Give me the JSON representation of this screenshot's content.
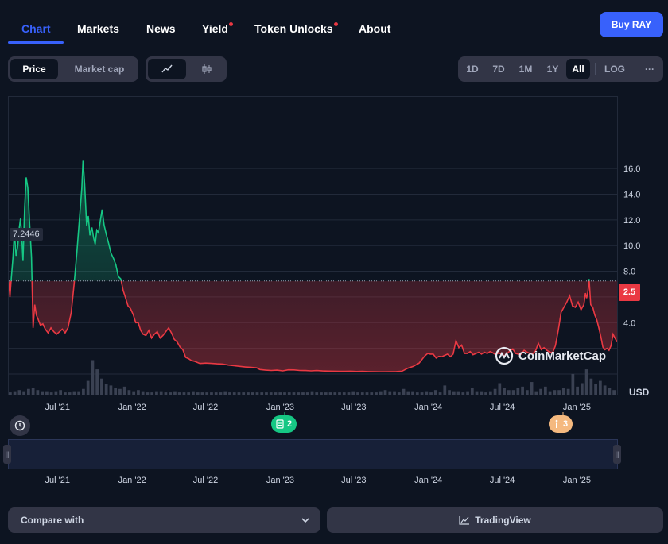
{
  "nav": {
    "tabs": [
      {
        "label": "Chart",
        "active": true
      },
      {
        "label": "Markets"
      },
      {
        "label": "News"
      },
      {
        "label": "Yield",
        "dot": true
      },
      {
        "label": "Token Unlocks",
        "dot": true
      },
      {
        "label": "About"
      }
    ],
    "buy_label": "Buy RAY"
  },
  "toolbar": {
    "metric_toggle": [
      "Price",
      "Market cap"
    ],
    "metric_selected": "Price",
    "chart_type_icons": [
      "line-chart-icon",
      "candlestick-icon"
    ],
    "ranges": [
      "1D",
      "7D",
      "1M",
      "1Y",
      "All"
    ],
    "range_selected": "All",
    "log_label": "LOG",
    "more_label": "···"
  },
  "chart": {
    "current_value_label": "7.2446",
    "last_price_label": "2.5",
    "currency_label": "USD",
    "watermark": "CoinMarketCap",
    "markers": [
      {
        "icon": "document-icon",
        "count": "2"
      },
      {
        "icon": "info-icon",
        "count": "3"
      }
    ]
  },
  "chart_data": {
    "type": "line",
    "ylim": [
      0,
      17
    ],
    "yticks": [
      4.0,
      6.0,
      8.0,
      10.0,
      12.0,
      14.0,
      16.0
    ],
    "ytick_labels": [
      "4.0",
      "6.0",
      "8.0",
      "10.0",
      "12.0",
      "14.0",
      "16.0"
    ],
    "xlim": [
      "2021-03-03",
      "2025-04-10"
    ],
    "xtick_dates": [
      "2021-07-01",
      "2022-01-01",
      "2022-07-01",
      "2023-01-01",
      "2023-07-01",
      "2024-01-01",
      "2024-07-01",
      "2025-01-01"
    ],
    "xtick_labels": [
      "Jul '21",
      "Jan '22",
      "Jul '22",
      "Jan '23",
      "Jul '23",
      "Jan '24",
      "Jul '24",
      "Jan '25"
    ],
    "baseline": 7.2446,
    "colors": {
      "up": "#16c784",
      "down": "#ea3943",
      "volume": "#3a4152",
      "navigator": "#3861fb"
    },
    "grid": true,
    "series": [
      {
        "points": [
          [
            "2021-03-03",
            7.2
          ],
          [
            "2021-03-06",
            6.0
          ],
          [
            "2021-03-09",
            7.4
          ],
          [
            "2021-03-13",
            8.9
          ],
          [
            "2021-03-17",
            11.0
          ],
          [
            "2021-03-21",
            9.2
          ],
          [
            "2021-03-25",
            9.9
          ],
          [
            "2021-03-29",
            11.4
          ],
          [
            "2021-04-01",
            12.1
          ],
          [
            "2021-04-04",
            10.8
          ],
          [
            "2021-04-07",
            8.8
          ],
          [
            "2021-04-11",
            12.8
          ],
          [
            "2021-04-15",
            15.3
          ],
          [
            "2021-04-19",
            14.5
          ],
          [
            "2021-04-23",
            12.0
          ],
          [
            "2021-04-28",
            9.1
          ],
          [
            "2021-05-02",
            3.6
          ],
          [
            "2021-05-06",
            5.4
          ],
          [
            "2021-05-10",
            4.6
          ],
          [
            "2021-05-14",
            4.3
          ],
          [
            "2021-05-20",
            3.8
          ],
          [
            "2021-05-26",
            3.9
          ],
          [
            "2021-06-01",
            3.5
          ],
          [
            "2021-06-08",
            3.2
          ],
          [
            "2021-06-15",
            3.6
          ],
          [
            "2021-06-22",
            3.3
          ],
          [
            "2021-06-29",
            3.1
          ],
          [
            "2021-07-06",
            3.3
          ],
          [
            "2021-07-13",
            3.5
          ],
          [
            "2021-07-20",
            3.2
          ],
          [
            "2021-07-27",
            3.6
          ],
          [
            "2021-08-04",
            4.8
          ],
          [
            "2021-08-11",
            7.0
          ],
          [
            "2021-08-18",
            9.5
          ],
          [
            "2021-08-25",
            12.4
          ],
          [
            "2021-08-30",
            14.5
          ],
          [
            "2021-09-02",
            16.6
          ],
          [
            "2021-09-06",
            14.8
          ],
          [
            "2021-09-11",
            11.5
          ],
          [
            "2021-09-15",
            12.3
          ],
          [
            "2021-09-19",
            10.8
          ],
          [
            "2021-09-24",
            11.4
          ],
          [
            "2021-09-28",
            10.6
          ],
          [
            "2021-10-02",
            10.1
          ],
          [
            "2021-10-06",
            11.2
          ],
          [
            "2021-10-10",
            11.0
          ],
          [
            "2021-10-15",
            12.0
          ],
          [
            "2021-10-19",
            12.8
          ],
          [
            "2021-10-24",
            11.6
          ],
          [
            "2021-10-29",
            10.9
          ],
          [
            "2021-11-04",
            10.2
          ],
          [
            "2021-11-10",
            9.4
          ],
          [
            "2021-11-16",
            9.0
          ],
          [
            "2021-11-22",
            8.5
          ],
          [
            "2021-11-28",
            7.6
          ],
          [
            "2021-12-04",
            7.4
          ],
          [
            "2021-12-10",
            6.5
          ],
          [
            "2021-12-16",
            5.9
          ],
          [
            "2021-12-22",
            5.3
          ],
          [
            "2021-12-28",
            5.1
          ],
          [
            "2022-01-04",
            4.6
          ],
          [
            "2022-01-10",
            4.0
          ],
          [
            "2022-01-16",
            4.0
          ],
          [
            "2022-01-22",
            3.4
          ],
          [
            "2022-01-28",
            3.1
          ],
          [
            "2022-02-04",
            3.0
          ],
          [
            "2022-02-11",
            3.4
          ],
          [
            "2022-02-18",
            2.8
          ],
          [
            "2022-02-25",
            3.1
          ],
          [
            "2022-03-04",
            3.3
          ],
          [
            "2022-03-11",
            2.8
          ],
          [
            "2022-03-18",
            3.0
          ],
          [
            "2022-03-25",
            3.3
          ],
          [
            "2022-04-01",
            3.6
          ],
          [
            "2022-04-08",
            3.2
          ],
          [
            "2022-04-15",
            2.7
          ],
          [
            "2022-04-22",
            2.5
          ],
          [
            "2022-04-29",
            2.1
          ],
          [
            "2022-05-06",
            1.9
          ],
          [
            "2022-05-13",
            1.3
          ],
          [
            "2022-05-20",
            1.2
          ],
          [
            "2022-05-27",
            1.05
          ],
          [
            "2022-06-03",
            1.0
          ],
          [
            "2022-06-17",
            0.82
          ],
          [
            "2022-07-01",
            0.85
          ],
          [
            "2022-07-15",
            0.83
          ],
          [
            "2022-07-29",
            0.8
          ],
          [
            "2022-08-12",
            0.78
          ],
          [
            "2022-08-26",
            0.7
          ],
          [
            "2022-09-09",
            0.65
          ],
          [
            "2022-09-23",
            0.6
          ],
          [
            "2022-10-07",
            0.55
          ],
          [
            "2022-10-21",
            0.52
          ],
          [
            "2022-11-04",
            0.48
          ],
          [
            "2022-11-12",
            0.35
          ],
          [
            "2022-11-26",
            0.3
          ],
          [
            "2022-12-10",
            0.28
          ],
          [
            "2022-12-24",
            0.3
          ],
          [
            "2023-01-07",
            0.25
          ],
          [
            "2023-01-21",
            0.33
          ],
          [
            "2023-02-04",
            0.32
          ],
          [
            "2023-02-18",
            0.28
          ],
          [
            "2023-03-04",
            0.27
          ],
          [
            "2023-03-18",
            0.25
          ],
          [
            "2023-04-01",
            0.27
          ],
          [
            "2023-04-15",
            0.24
          ],
          [
            "2023-04-29",
            0.23
          ],
          [
            "2023-05-13",
            0.22
          ],
          [
            "2023-05-27",
            0.21
          ],
          [
            "2023-06-10",
            0.21
          ],
          [
            "2023-06-24",
            0.22
          ],
          [
            "2023-07-08",
            0.2
          ],
          [
            "2023-07-22",
            0.21
          ],
          [
            "2023-08-05",
            0.19
          ],
          [
            "2023-08-19",
            0.18
          ],
          [
            "2023-09-02",
            0.17
          ],
          [
            "2023-09-16",
            0.17
          ],
          [
            "2023-09-30",
            0.18
          ],
          [
            "2023-10-14",
            0.19
          ],
          [
            "2023-10-28",
            0.22
          ],
          [
            "2023-11-11",
            0.45
          ],
          [
            "2023-11-25",
            0.6
          ],
          [
            "2023-12-09",
            0.85
          ],
          [
            "2023-12-23",
            1.4
          ],
          [
            "2023-12-30",
            1.6
          ],
          [
            "2024-01-06",
            1.55
          ],
          [
            "2024-01-13",
            1.55
          ],
          [
            "2024-01-20",
            1.25
          ],
          [
            "2024-01-27",
            1.38
          ],
          [
            "2024-02-03",
            1.35
          ],
          [
            "2024-02-10",
            1.45
          ],
          [
            "2024-02-17",
            1.55
          ],
          [
            "2024-02-24",
            1.35
          ],
          [
            "2024-03-02",
            1.55
          ],
          [
            "2024-03-09",
            2.6
          ],
          [
            "2024-03-16",
            2.05
          ],
          [
            "2024-03-23",
            2.25
          ],
          [
            "2024-03-30",
            1.6
          ],
          [
            "2024-04-06",
            1.6
          ],
          [
            "2024-04-13",
            1.75
          ],
          [
            "2024-04-20",
            1.5
          ],
          [
            "2024-04-27",
            1.6
          ],
          [
            "2024-05-04",
            1.7
          ],
          [
            "2024-05-11",
            1.55
          ],
          [
            "2024-05-18",
            1.7
          ],
          [
            "2024-05-25",
            1.6
          ],
          [
            "2024-06-01",
            1.75
          ],
          [
            "2024-06-08",
            1.65
          ],
          [
            "2024-06-15",
            1.5
          ],
          [
            "2024-06-22",
            1.65
          ],
          [
            "2024-06-29",
            1.55
          ],
          [
            "2024-07-06",
            1.4
          ],
          [
            "2024-07-13",
            1.6
          ],
          [
            "2024-07-20",
            1.8
          ],
          [
            "2024-07-27",
            1.95
          ],
          [
            "2024-08-03",
            1.6
          ],
          [
            "2024-08-10",
            1.55
          ],
          [
            "2024-08-17",
            1.55
          ],
          [
            "2024-08-24",
            1.85
          ],
          [
            "2024-08-31",
            1.7
          ],
          [
            "2024-09-07",
            1.6
          ],
          [
            "2024-09-14",
            1.55
          ],
          [
            "2024-09-21",
            1.8
          ],
          [
            "2024-09-28",
            2.4
          ],
          [
            "2024-10-05",
            1.9
          ],
          [
            "2024-10-12",
            2.05
          ],
          [
            "2024-10-19",
            1.85
          ],
          [
            "2024-10-26",
            1.7
          ],
          [
            "2024-11-02",
            1.65
          ],
          [
            "2024-11-09",
            2.2
          ],
          [
            "2024-11-16",
            3.4
          ],
          [
            "2024-11-23",
            4.8
          ],
          [
            "2024-11-30",
            5.2
          ],
          [
            "2024-12-07",
            5.6
          ],
          [
            "2024-12-14",
            6.1
          ],
          [
            "2024-12-21",
            5.3
          ],
          [
            "2024-12-28",
            5.2
          ],
          [
            "2025-01-04",
            5.6
          ],
          [
            "2025-01-11",
            5.0
          ],
          [
            "2025-01-18",
            5.4
          ],
          [
            "2025-01-22",
            6.3
          ],
          [
            "2025-01-25",
            5.9
          ],
          [
            "2025-01-28",
            6.4
          ],
          [
            "2025-01-31",
            7.4
          ],
          [
            "2025-02-04",
            5.4
          ],
          [
            "2025-02-09",
            5.2
          ],
          [
            "2025-02-14",
            4.6
          ],
          [
            "2025-02-19",
            4.2
          ],
          [
            "2025-02-24",
            3.6
          ],
          [
            "2025-03-01",
            2.9
          ],
          [
            "2025-03-06",
            2.1
          ],
          [
            "2025-03-11",
            1.9
          ],
          [
            "2025-03-16",
            2.0
          ],
          [
            "2025-03-21",
            1.85
          ],
          [
            "2025-03-26",
            2.2
          ],
          [
            "2025-03-31",
            3.1
          ],
          [
            "2025-04-05",
            2.8
          ],
          [
            "2025-04-10",
            2.5
          ]
        ]
      }
    ],
    "volume": [
      2,
      3,
      4,
      3,
      5,
      6,
      4,
      3,
      3,
      2,
      3,
      4,
      2,
      2,
      3,
      3,
      5,
      12,
      30,
      22,
      14,
      9,
      8,
      6,
      5,
      7,
      4,
      3,
      4,
      3,
      2,
      2,
      3,
      3,
      2,
      2,
      3,
      2,
      2,
      2,
      3,
      2,
      2,
      2,
      2,
      2,
      2,
      3,
      2,
      2,
      2,
      2,
      2,
      2,
      2,
      2,
      2,
      2,
      2,
      2,
      2,
      2,
      2,
      2,
      2,
      2,
      3,
      2,
      2,
      2,
      2,
      2,
      2,
      2,
      2,
      3,
      2,
      2,
      2,
      2,
      2,
      3,
      4,
      3,
      3,
      2,
      5,
      3,
      3,
      2,
      2,
      3,
      2,
      4,
      2,
      8,
      4,
      3,
      3,
      2,
      3,
      6,
      3,
      3,
      2,
      3,
      5,
      10,
      6,
      4,
      4,
      6,
      7,
      4,
      11,
      3,
      5,
      7,
      3,
      4,
      4,
      6,
      5,
      18,
      7,
      10,
      22,
      14,
      9,
      12,
      8,
      6,
      4
    ]
  },
  "bottom": {
    "compare_label": "Compare with",
    "tradingview_label": "TradingView"
  }
}
